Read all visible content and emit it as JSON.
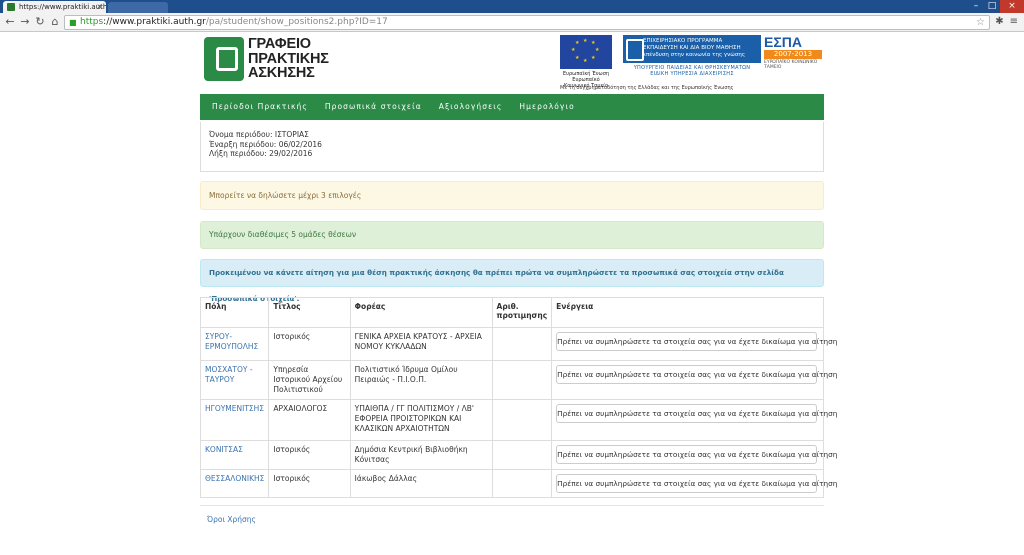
{
  "browser": {
    "tab_title": "https://www.praktiki.auth",
    "url_scheme": "https",
    "url_host": "://www.praktiki.auth.gr",
    "url_path": "/pa/student/show_positions2.php?ID=17"
  },
  "header": {
    "logo_text": "ΓΡΑΦΕΙΟ\nΠΡΑΚΤΙΚΗΣ\nΑΣΚΗΣΗΣ",
    "eu_caption": "Ευρωπαϊκή Ένωση\nΕυρωπαϊκό Κοινωνικό Ταμείο",
    "epanek_banner": "ΕΠΙΧΕΙΡΗΣΙΑΚΟ ΠΡΟΓΡΑΜΜΑ\nΕΚΠΑΙΔΕΥΣΗ ΚΑΙ ΔΙΑ ΒΙΟΥ ΜΑΘΗΣΗ\nεπένδυση στην κοινωνία της γνώσης",
    "epanek_sub": "ΥΠΟΥΡΓΕΙΟ ΠΑΙΔΕΙΑΣ ΚΑΙ ΘΡΗΣΚΕΥΜΑΤΩΝ\nΕΙΔΙΚΗ ΥΠΗΡΕΣΙΑ ΔΙΑΧΕΙΡΙΣΗΣ",
    "espa_logo": "ΕΣΠΑ",
    "espa_years": "2007-2013",
    "espa_caption": "ΕΥΡΩΠΑΪΚΟ ΚΟΙΝΩΝΙΚΟ ΤΑΜΕΙΟ",
    "cofund_text": "Με τη συγχρηματοδότηση της Ελλάδας και της Ευρωπαϊκής Ένωσης"
  },
  "nav": {
    "items": [
      "Περίοδοι Πρακτικής",
      "Προσωπικά στοιχεία",
      "Αξιολογήσεις",
      "Ημερολόγιο"
    ]
  },
  "period": {
    "name": "Όνομα περιόδου: ΙΣΤΟΡΙΑΣ",
    "start": "Έναρξη περιόδου: 06/02/2016",
    "end": "Λήξη περιόδου: 29/02/2016"
  },
  "alerts": {
    "warning": "Μπορείτε να δηλώσετε μέχρι 3 επιλογές",
    "success": "Υπάρχουν διαθέσιμες 5 ομάδες θέσεων",
    "info": "Προκειμένου να κάνετε αίτηση για μια θέση πρακτικής άσκησης θα πρέπει πρώτα να συμπληρώσετε τα προσωπικά σας στοιχεία στην σελίδα 'Προσωπικά στοιχεία'."
  },
  "table": {
    "headers": [
      "Πόλη",
      "Τίτλος",
      "Φορέας",
      "Αριθ. προτιμησης",
      "Ενέργεια"
    ],
    "button_label": "Πρέπει να συμπληρώσετε τα στοιχεία σας για να έχετε δικαίωμα για αίτηση",
    "rows": [
      {
        "city": "ΣΥΡΟΥ-ΕΡΜΟΥΠΟΛΗΣ",
        "title": "Ιστορικός",
        "org": "ΓΕΝΙΚΑ ΑΡΧΕΙΑ ΚΡΑΤΟΥΣ - ΑΡΧΕΙΑ ΝΟΜΟΥ ΚΥΚΛΑΔΩΝ",
        "num": ""
      },
      {
        "city": "ΜΟΣΧΑΤΟΥ - ΤΑΥΡΟΥ",
        "title": "Υπηρεσία Ιστορικού Αρχείου Πολιτιστικού",
        "org": "Πολιτιστικό Ίδρυμα Ομίλου Πειραιώς - Π.Ι.Ο.Π.",
        "num": ""
      },
      {
        "city": "ΗΓΟΥΜΕΝΙΤΣΗΣ",
        "title": "ΑΡΧΑΙΟΛΟΓΟΣ",
        "org": "ΥΠΑΙΘΠΑ / ΓΓ ΠΟΛΙΤΙΣΜΟΥ / ΛΒ' ΕΦΟΡΕΙΑ ΠΡΟΙΣΤΟΡΙΚΩΝ ΚΑΙ ΚΛΑΣΙΚΩΝ ΑΡΧΑΙΟΤΗΤΩΝ",
        "num": ""
      },
      {
        "city": "ΚΟΝΙΤΣΑΣ",
        "title": "Ιστορικός",
        "org": "Δημόσια Κεντρική Βιβλιοθήκη Κόνιτσας",
        "num": ""
      },
      {
        "city": "ΘΕΣΣΑΛΟΝΙΚΗΣ",
        "title": "Ιστορικός",
        "org": "Ιάκωβος Δάλλας",
        "num": ""
      }
    ]
  },
  "footer": {
    "terms_link": "Όροι Χρήσης"
  }
}
